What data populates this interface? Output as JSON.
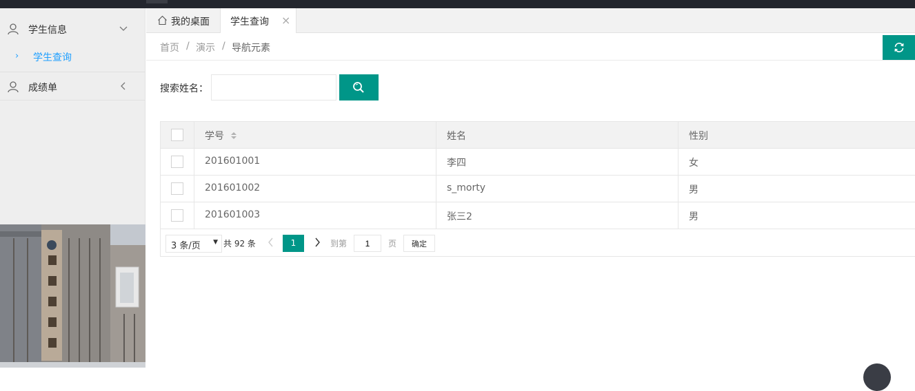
{
  "sidebar": {
    "items": [
      {
        "label": "学生信息",
        "icon": "user-icon",
        "expanded": true
      },
      {
        "label": "学生查询",
        "active": true
      },
      {
        "label": "成绩单",
        "icon": "user-icon",
        "expanded": false
      }
    ]
  },
  "tabs": [
    {
      "label": "我的桌面",
      "icon": "home-icon"
    },
    {
      "label": "学生查询",
      "closable": true,
      "active": true
    }
  ],
  "breadcrumb": [
    "首页",
    "演示",
    "导航元素"
  ],
  "breadcrumb_sep": "/",
  "search": {
    "label": "搜索姓名：",
    "value": "",
    "placeholder": ""
  },
  "table": {
    "headers": [
      "学号",
      "姓名",
      "性别"
    ],
    "rows": [
      [
        "201601001",
        "李四",
        "女"
      ],
      [
        "201601002",
        "s_morty",
        "男"
      ],
      [
        "201601003",
        "张三2",
        "男"
      ]
    ]
  },
  "pagination": {
    "limit": "3 条/页",
    "total": "共 92 条",
    "current_page": "1",
    "goto_label": "到第",
    "goto_value": "1",
    "page_label": "页",
    "confirm_label": "确定"
  },
  "colors": {
    "accent": "#009688",
    "link": "#1e9fff",
    "topbar": "#23262e"
  }
}
